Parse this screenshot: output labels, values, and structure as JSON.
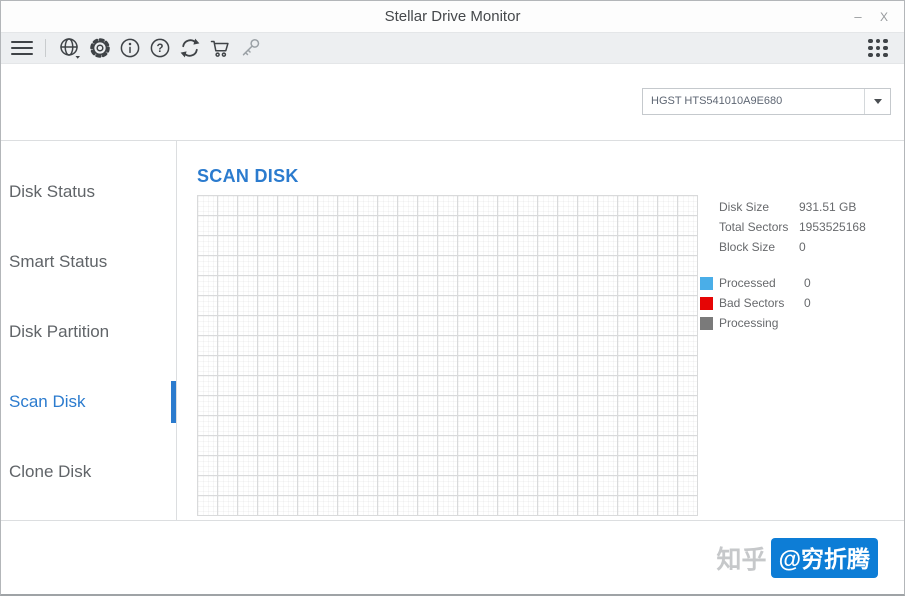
{
  "colors": {
    "accent": "#2b7bce",
    "legend_processed": "#4aaee8",
    "legend_bad": "#e60505",
    "legend_processing": "#7a7a7a",
    "badge_bg": "#0d7dd6"
  },
  "window": {
    "title": "Stellar Drive Monitor",
    "minimize_label": "–",
    "close_label": "X"
  },
  "toolbar": {
    "icons": [
      "menu-icon",
      "globe-icon",
      "settings-gear-icon",
      "info-icon",
      "help-icon",
      "refresh-icon",
      "cart-icon",
      "license-key-icon",
      "apps-grid-icon"
    ]
  },
  "device_selector": {
    "value": "HGST HTS541010A9E680"
  },
  "sidebar": {
    "items": [
      {
        "label": "Disk Status",
        "active": false
      },
      {
        "label": "Smart Status",
        "active": false
      },
      {
        "label": "Disk Partition",
        "active": false
      },
      {
        "label": "Scan Disk",
        "active": true
      },
      {
        "label": "Clone Disk",
        "active": false
      }
    ]
  },
  "main": {
    "title": "SCAN DISK",
    "grid": {
      "rows": 16,
      "columns": 25
    },
    "info": [
      {
        "label": "Disk Size",
        "value": "931.51 GB"
      },
      {
        "label": "Total Sectors",
        "value": "1953525168"
      },
      {
        "label": "Block Size",
        "value": "0"
      }
    ],
    "legend": [
      {
        "label": "Processed",
        "value": "0",
        "color": "#4aaee8"
      },
      {
        "label": "Bad Sectors",
        "value": "0",
        "color": "#e60505"
      },
      {
        "label": "Processing",
        "value": "",
        "color": "#7a7a7a"
      }
    ]
  },
  "watermark": {
    "prefix": "知乎",
    "handle": "@穷折腾"
  }
}
